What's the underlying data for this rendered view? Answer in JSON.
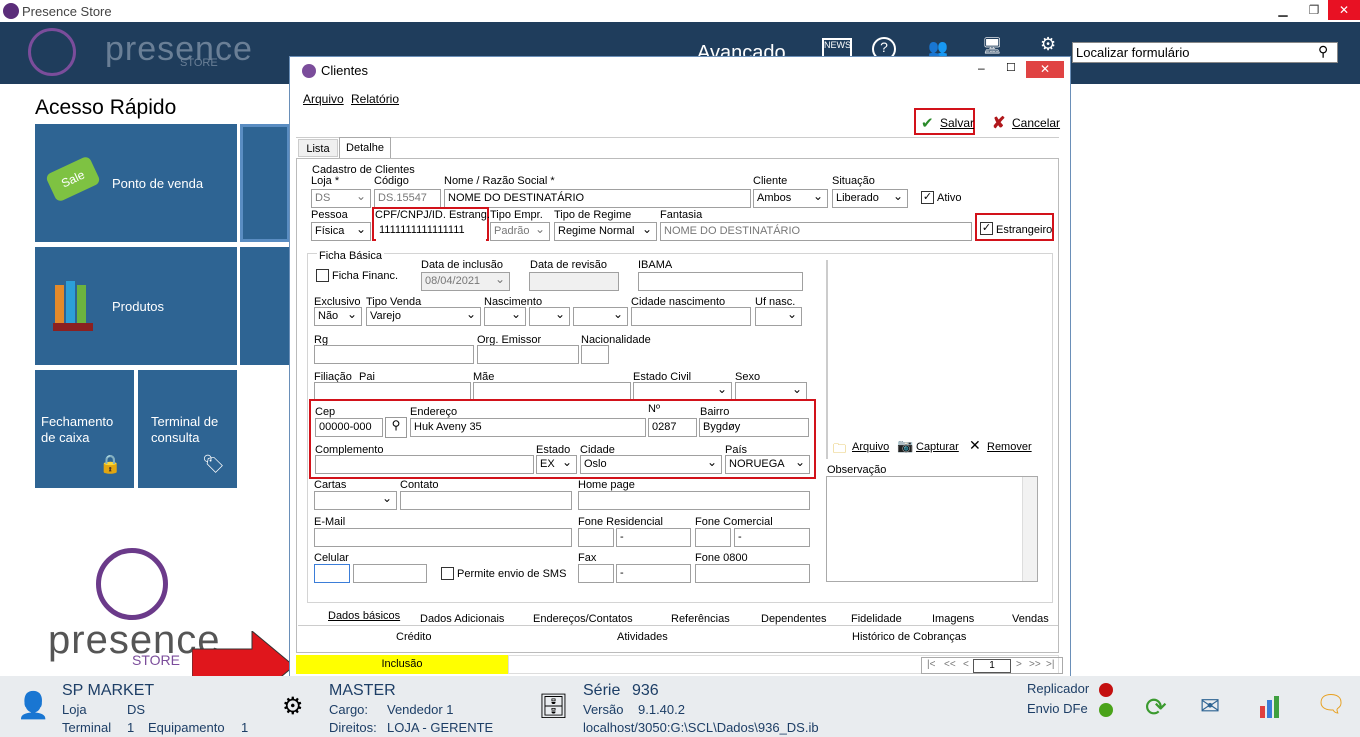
{
  "app": {
    "title": "Presence Store",
    "brand": "presence",
    "brand_sub": "STORE",
    "nav_label": "Avançado",
    "search_placeholder": "Localizar formulário"
  },
  "access": {
    "title": "Acesso Rápido",
    "tiles": [
      {
        "label": "Ponto de venda"
      },
      {
        "label": "Produtos"
      },
      {
        "label": "Fechamento de caixa"
      },
      {
        "label": "Terminal de consulta"
      }
    ]
  },
  "dialog": {
    "title": "Clientes",
    "menu": [
      "Arquivo",
      "Relatório"
    ],
    "save": "Salvar",
    "cancel": "Cancelar",
    "tabs_top": [
      "Lista",
      "Detalhe"
    ],
    "section": "Cadastro de Clientes",
    "labels": {
      "loja": "Loja *",
      "codigo": "Código",
      "nome": "Nome / Razão Social *",
      "cliente": "Cliente",
      "situacao": "Situação",
      "ativo": "Ativo",
      "pessoa": "Pessoa",
      "cpf": "CPF/CNPJ/ID. Estrang.",
      "tipo_empr": "Tipo Empr.",
      "tipo_regime": "Tipo de Regime",
      "fantasia": "Fantasia",
      "estrangeiro": "Estrangeiro"
    },
    "values": {
      "loja": "DS",
      "codigo": "DS.15547",
      "nome": "NOME DO DESTINATÁRIO",
      "cliente": "Ambos",
      "situacao": "Liberado",
      "pessoa": "Física",
      "cpf": "1111111111111111",
      "tipo_empr": "Padrão",
      "tipo_regime": "Regime Normal",
      "fantasia": "NOME DO DESTINATÁRIO"
    },
    "ficha": {
      "title": "Ficha Básica",
      "ficha_financ": "Ficha Financ.",
      "data_inclusao": "Data de inclusão",
      "data_inclusao_val": "08/04/2021",
      "data_revisao": "Data de revisão",
      "ibama": "IBAMA",
      "exclusivo": "Exclusivo",
      "exclusivo_val": "Não",
      "tipo_venda": "Tipo Venda",
      "tipo_venda_val": "Varejo",
      "nascimento": "Nascimento",
      "cidade_nasc": "Cidade nascimento",
      "uf_nasc": "Uf nasc.",
      "rg": "Rg",
      "org_emissor": "Org. Emissor",
      "nacionalidade": "Nacionalidade",
      "filiacao": "Filiação",
      "pai": "Pai",
      "mae": "Mãe",
      "estado_civil": "Estado Civil",
      "sexo": "Sexo",
      "cep": "Cep",
      "cep_val": "00000-000",
      "endereco": "Endereço",
      "endereco_val": "Huk Aveny 35",
      "numero": "Nº",
      "numero_val": "0287",
      "bairro": "Bairro",
      "bairro_val": "Bygdøy",
      "complemento": "Complemento",
      "estado": "Estado",
      "estado_val": "EX",
      "cidade": "Cidade",
      "cidade_val": "Oslo",
      "pais": "País",
      "pais_val": "NORUEGA",
      "cartas": "Cartas",
      "contato": "Contato",
      "homepage": "Home page",
      "email": "E-Mail",
      "fone_res": "Fone Residencial",
      "fone_com": "Fone Comercial",
      "celular": "Celular",
      "sms": "Permite envio de SMS",
      "fax": "Fax",
      "fone0800": "Fone 0800",
      "dash": "-",
      "arquivo": "Arquivo",
      "capturar": "Capturar",
      "remover": "Remover",
      "observacao": "Observação"
    },
    "tabs_bottom": [
      "Dados básicos",
      "Dados Adicionais",
      "Endereços/Contatos",
      "Referências",
      "Dependentes",
      "Fidelidade",
      "Imagens",
      "Vendas"
    ],
    "tabs_bottom2": [
      "Crédito",
      "Atividades",
      "Histórico de Cobranças"
    ],
    "status": "Inclusão",
    "page": "1",
    "nav": {
      "first": "|<",
      "prev2": "<<",
      "prev": "<",
      "next": ">",
      "next2": ">>",
      "last": ">|"
    }
  },
  "footer": {
    "company": "SP MARKET",
    "loja_label": "Loja",
    "loja": "DS",
    "terminal_label": "Terminal",
    "terminal": "1",
    "equip_label": "Equipamento",
    "equip": "1",
    "user": "MASTER",
    "cargo_label": "Cargo:",
    "cargo": "Vendedor 1",
    "direitos_label": "Direitos:",
    "direitos": "LOJA - GERENTE",
    "serie_label": "Série",
    "serie": "936",
    "versao_label": "Versão",
    "versao": "9.1.40.2",
    "db": "localhost/3050:G:\\SCL\\Dados\\936_DS.ib",
    "replicador": "Replicador",
    "envio": "Envio DFe"
  },
  "colors": {
    "accent": "#d2121a",
    "header": "#1f3d5c",
    "tile": "#2e6493",
    "status": "#ffff00"
  }
}
